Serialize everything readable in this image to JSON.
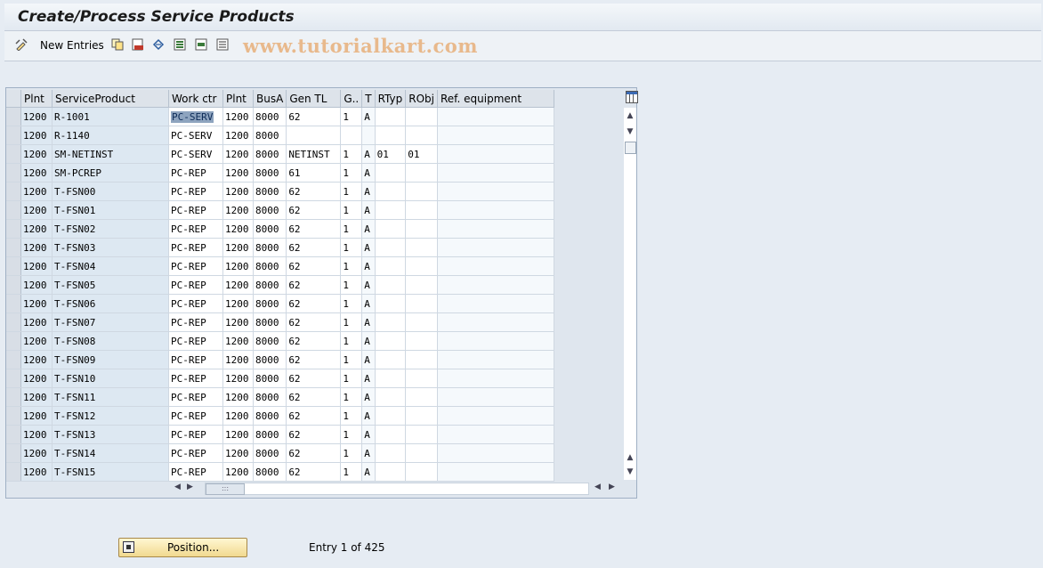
{
  "title": "Create/Process Service Products",
  "toolbar": {
    "new_entries": "New Entries",
    "watermark": "www.tutorialkart.com"
  },
  "table": {
    "columns": [
      "Plnt",
      "ServiceProduct",
      "Work ctr",
      "Plnt",
      "BusA",
      "Gen TL",
      "G..",
      "T",
      "RTyp",
      "RObj",
      "Ref. equipment"
    ],
    "rows": [
      [
        "1200",
        "R-1001",
        "PC-SERV",
        "1200",
        "8000",
        "62",
        "1",
        "A",
        "",
        "",
        ""
      ],
      [
        "1200",
        "R-1140",
        "PC-SERV",
        "1200",
        "8000",
        "",
        "",
        "",
        "",
        "",
        ""
      ],
      [
        "1200",
        "SM-NETINST",
        "PC-SERV",
        "1200",
        "8000",
        "NETINST",
        "1",
        "A",
        "01",
        "01",
        ""
      ],
      [
        "1200",
        "SM-PCREP",
        "PC-REP",
        "1200",
        "8000",
        "61",
        "1",
        "A",
        "",
        "",
        ""
      ],
      [
        "1200",
        "T-FSN00",
        "PC-REP",
        "1200",
        "8000",
        "62",
        "1",
        "A",
        "",
        "",
        ""
      ],
      [
        "1200",
        "T-FSN01",
        "PC-REP",
        "1200",
        "8000",
        "62",
        "1",
        "A",
        "",
        "",
        ""
      ],
      [
        "1200",
        "T-FSN02",
        "PC-REP",
        "1200",
        "8000",
        "62",
        "1",
        "A",
        "",
        "",
        ""
      ],
      [
        "1200",
        "T-FSN03",
        "PC-REP",
        "1200",
        "8000",
        "62",
        "1",
        "A",
        "",
        "",
        ""
      ],
      [
        "1200",
        "T-FSN04",
        "PC-REP",
        "1200",
        "8000",
        "62",
        "1",
        "A",
        "",
        "",
        ""
      ],
      [
        "1200",
        "T-FSN05",
        "PC-REP",
        "1200",
        "8000",
        "62",
        "1",
        "A",
        "",
        "",
        ""
      ],
      [
        "1200",
        "T-FSN06",
        "PC-REP",
        "1200",
        "8000",
        "62",
        "1",
        "A",
        "",
        "",
        ""
      ],
      [
        "1200",
        "T-FSN07",
        "PC-REP",
        "1200",
        "8000",
        "62",
        "1",
        "A",
        "",
        "",
        ""
      ],
      [
        "1200",
        "T-FSN08",
        "PC-REP",
        "1200",
        "8000",
        "62",
        "1",
        "A",
        "",
        "",
        ""
      ],
      [
        "1200",
        "T-FSN09",
        "PC-REP",
        "1200",
        "8000",
        "62",
        "1",
        "A",
        "",
        "",
        ""
      ],
      [
        "1200",
        "T-FSN10",
        "PC-REP",
        "1200",
        "8000",
        "62",
        "1",
        "A",
        "",
        "",
        ""
      ],
      [
        "1200",
        "T-FSN11",
        "PC-REP",
        "1200",
        "8000",
        "62",
        "1",
        "A",
        "",
        "",
        ""
      ],
      [
        "1200",
        "T-FSN12",
        "PC-REP",
        "1200",
        "8000",
        "62",
        "1",
        "A",
        "",
        "",
        ""
      ],
      [
        "1200",
        "T-FSN13",
        "PC-REP",
        "1200",
        "8000",
        "62",
        "1",
        "A",
        "",
        "",
        ""
      ],
      [
        "1200",
        "T-FSN14",
        "PC-REP",
        "1200",
        "8000",
        "62",
        "1",
        "A",
        "",
        "",
        ""
      ],
      [
        "1200",
        "T-FSN15",
        "PC-REP",
        "1200",
        "8000",
        "62",
        "1",
        "A",
        "",
        "",
        ""
      ]
    ]
  },
  "footer": {
    "position_button": "Position...",
    "entry_info": "Entry 1 of 425"
  },
  "colors": {
    "background": "#e6ecf3",
    "key_column": "#dde8f2",
    "selected_cell": "#8ea4bf",
    "button": "#f1d98f"
  },
  "icons": [
    "display-change-icon",
    "copy-icon",
    "delete-icon",
    "undo-icon",
    "select-all-icon",
    "select-block-icon",
    "deselect-all-icon",
    "table-settings-icon",
    "position-icon"
  ]
}
